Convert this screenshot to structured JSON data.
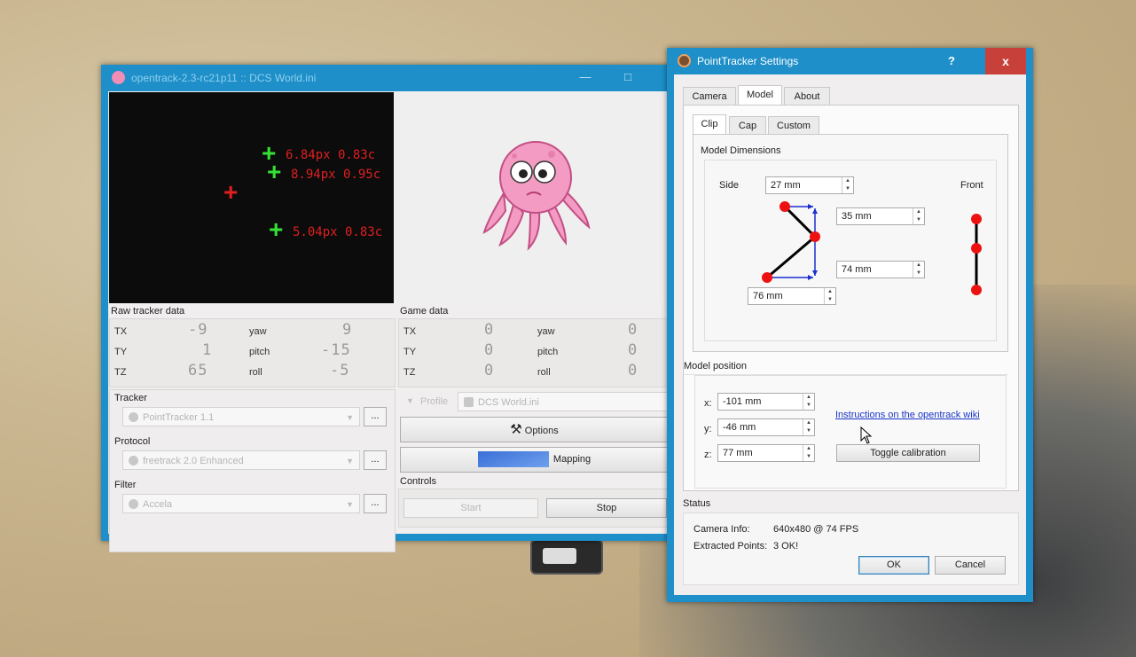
{
  "main_window": {
    "title": "opentrack-2.3-rc21p11 :: DCS World.ini",
    "tracker_overlay": {
      "labels": [
        "6.84px 0.83c",
        "8.94px 0.95c",
        "5.04px 0.83c"
      ]
    },
    "raw_tracker_data": {
      "label": "Raw tracker data",
      "rows": [
        {
          "axis": "TX",
          "value": "-9",
          "rot": "yaw",
          "rot_value": "9"
        },
        {
          "axis": "TY",
          "value": "1",
          "rot": "pitch",
          "rot_value": "-15"
        },
        {
          "axis": "TZ",
          "value": "65",
          "rot": "roll",
          "rot_value": "-5"
        }
      ]
    },
    "game_data": {
      "label": "Game data",
      "rows": [
        {
          "axis": "TX",
          "value": "0",
          "rot": "yaw",
          "rot_value": "0"
        },
        {
          "axis": "TY",
          "value": "0",
          "rot": "pitch",
          "rot_value": "0"
        },
        {
          "axis": "TZ",
          "value": "0",
          "rot": "roll",
          "rot_value": "0"
        }
      ]
    },
    "tracker": {
      "label": "Tracker",
      "value": "PointTracker 1.1"
    },
    "protocol": {
      "label": "Protocol",
      "value": "freetrack 2.0 Enhanced"
    },
    "filter": {
      "label": "Filter",
      "value": "Accela"
    },
    "dots_label": "...",
    "profile": {
      "label": "Profile",
      "value": "DCS World.ini"
    },
    "options_label": "Options",
    "mapping_label": "Mapping",
    "controls_label": "Controls",
    "start_label": "Start",
    "stop_label": "Stop"
  },
  "settings": {
    "title": "PointTracker Settings",
    "help_label": "?",
    "close_label": "x",
    "tabs": [
      "Camera",
      "Model",
      "About"
    ],
    "subtabs": [
      "Clip",
      "Cap",
      "Custom"
    ],
    "model_dimensions": {
      "label": "Model Dimensions",
      "side_label": "Side",
      "front_label": "Front",
      "fields": [
        "27 mm",
        "35 mm",
        "74 mm",
        "76 mm"
      ]
    },
    "model_position": {
      "label": "Model position",
      "x_label": "x:",
      "x_value": "-101 mm",
      "y_label": "y:",
      "y_value": "-46 mm",
      "z_label": "z:",
      "z_value": "77 mm",
      "wiki_link": "Instructions on the opentrack wiki",
      "toggle_label": "Toggle calibration"
    },
    "status": {
      "label": "Status",
      "camera_info_label": "Camera Info:",
      "camera_info_value": "640x480 @ 74 FPS",
      "extracted_label": "Extracted Points:",
      "extracted_value": "3 OK!"
    },
    "ok_label": "OK",
    "cancel_label": "Cancel"
  },
  "colors": {
    "titlebar": "#1e8fc9",
    "point_green": "#35e035",
    "point_red": "#e01f1f",
    "model_dot": "#ee1111",
    "model_arrow": "#1a2fd0",
    "close": "#c7403a"
  }
}
